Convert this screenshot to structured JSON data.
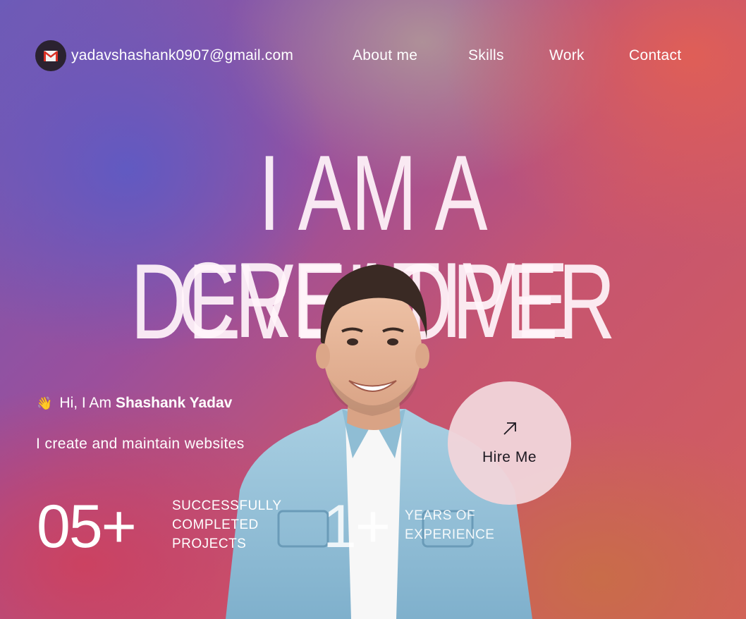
{
  "header": {
    "email": "yadavshashank0907@gmail.com",
    "nav": {
      "about": "About me",
      "skills": "Skills",
      "work": "Work",
      "contact": "Contact"
    }
  },
  "hero": {
    "headline_line1": "I AM A CREATIVE",
    "headline_line2": "DEVELOPER",
    "greeting_prefix": "Hi, I Am",
    "name": "Shashank Yadav",
    "tagline": "I create and maintain websites"
  },
  "stats": [
    {
      "value": "05+",
      "label": "SUCCESSFULLY COMPLETED PROJECTS"
    },
    {
      "value": "1+",
      "label": "YEARS OF EXPERIENCE"
    }
  ],
  "cta": {
    "label": "Hire Me",
    "icon": "arrow-up-right-icon"
  },
  "icons": {
    "email": "gmail-icon",
    "wave": "waving-hand-icon"
  },
  "colors": {
    "gradient_start": "#6c5bb8",
    "gradient_mid": "#9b4f9c",
    "gradient_end": "#d45f5c",
    "cta_bg": "#f0d4da",
    "headline": "#fff4fa"
  }
}
